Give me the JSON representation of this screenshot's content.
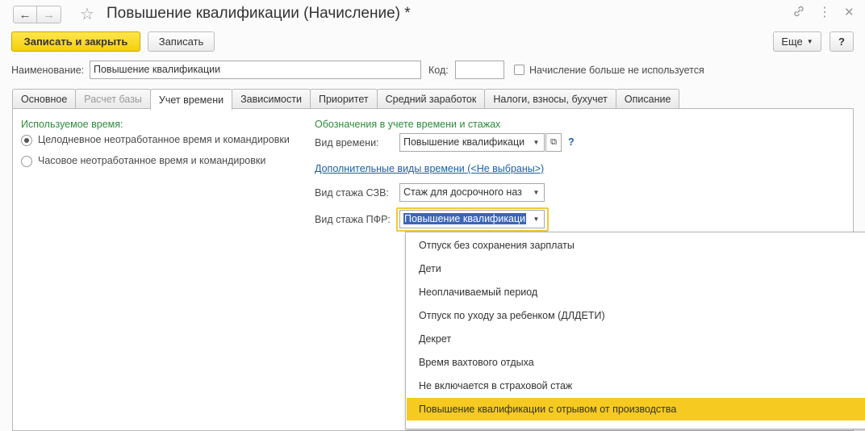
{
  "window": {
    "title": "Повышение квалификации (Начисление) *",
    "back_icon": "arrow-left-icon",
    "forward_icon": "arrow-right-icon"
  },
  "toolbar": {
    "save_close_label": "Записать и закрыть",
    "save_label": "Записать",
    "more_label": "Еще",
    "help_label": "?"
  },
  "header_fields": {
    "name_label": "Наименование:",
    "name_value": "Повышение квалификации",
    "code_label": "Код:",
    "code_value": "",
    "unused_label": "Начисление больше не используется",
    "unused_checked": false
  },
  "tabs": [
    {
      "label": "Основное",
      "state": "normal"
    },
    {
      "label": "Расчет базы",
      "state": "disabled"
    },
    {
      "label": "Учет времени",
      "state": "active"
    },
    {
      "label": "Зависимости",
      "state": "normal"
    },
    {
      "label": "Приоритет",
      "state": "normal"
    },
    {
      "label": "Средний заработок",
      "state": "normal"
    },
    {
      "label": "Налоги, взносы, бухучет",
      "state": "normal"
    },
    {
      "label": "Описание",
      "state": "normal"
    }
  ],
  "time_used": {
    "heading": "Используемое время:",
    "options": [
      {
        "label": "Целодневное неотработанное время и командировки",
        "selected": true
      },
      {
        "label": "Часовое неотработанное время и командировки",
        "selected": false
      }
    ]
  },
  "designations": {
    "heading": "Обозначения в учете времени и стажах",
    "time_kind_label": "Вид времени:",
    "time_kind_value": "Повышение квалификаци",
    "extra_link": "Дополнительные виды времени (<Не выбраны>)",
    "szv_label": "Вид стажа СЗВ:",
    "szv_value": "Стаж для досрочного наз",
    "pfr_label": "Вид стажа ПФР:",
    "pfr_value": "Повышение квалификаци",
    "help_mark": "?"
  },
  "dropdown_items": [
    "Отпуск без сохранения зарплаты",
    "Дети",
    "Неоплачиваемый период",
    "Отпуск по уходу за ребенком (ДЛДЕТИ)",
    "Декрет",
    "Время вахтового отдыха",
    "Не включается в страховой стаж",
    "Повышение квалификации с отрывом от производства"
  ],
  "dropdown_highlighted": "Повышение квалификации с отрывом от производства",
  "colors": {
    "accent_yellow": "#f6ca20",
    "green_heading": "#2e8b3d",
    "link_blue": "#1c5fa8",
    "selection_blue": "#3b65b6"
  }
}
